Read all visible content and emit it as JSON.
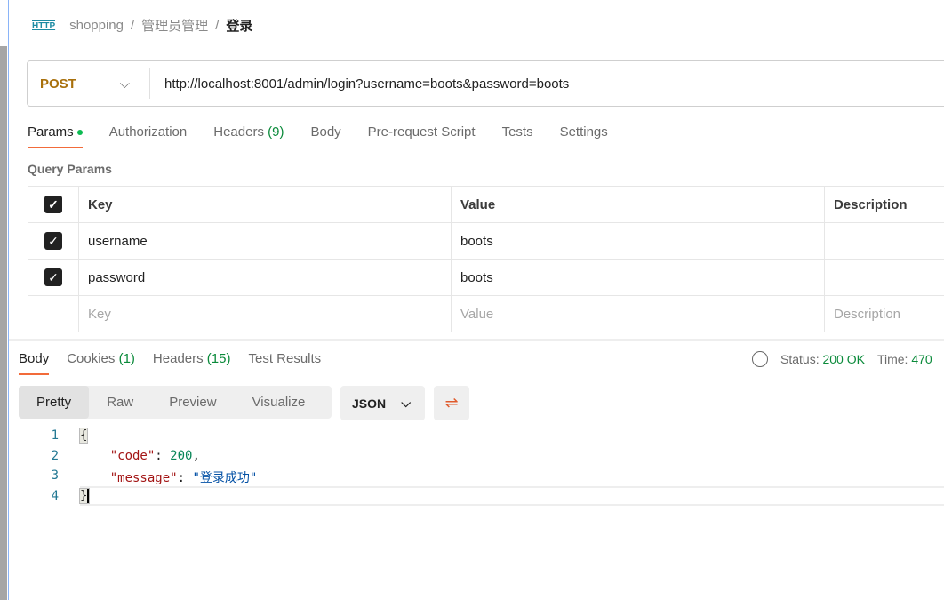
{
  "breadcrumb": {
    "icon": "HTTP",
    "items": [
      "shopping",
      "管理员管理",
      "登录"
    ]
  },
  "request": {
    "method": "POST",
    "url": "http://localhost:8001/admin/login?username=boots&password=boots"
  },
  "request_tabs": [
    {
      "label": "Params"
    },
    {
      "label": "Authorization"
    },
    {
      "label": "Headers",
      "count": "(9)"
    },
    {
      "label": "Body"
    },
    {
      "label": "Pre-request Script"
    },
    {
      "label": "Tests"
    },
    {
      "label": "Settings"
    }
  ],
  "query_params": {
    "title": "Query Params",
    "columns": [
      "Key",
      "Value",
      "Description"
    ],
    "rows": [
      {
        "key": "username",
        "value": "boots",
        "description": ""
      },
      {
        "key": "password",
        "value": "boots",
        "description": ""
      }
    ],
    "placeholder": {
      "key": "Key",
      "value": "Value",
      "description": "Description"
    }
  },
  "response_tabs": [
    {
      "label": "Body"
    },
    {
      "label": "Cookies",
      "count": "(1)"
    },
    {
      "label": "Headers",
      "count": "(15)"
    },
    {
      "label": "Test Results"
    }
  ],
  "status": {
    "label": "Status:",
    "value": "200 OK",
    "time_label": "Time:",
    "time_value": "470"
  },
  "view_modes": [
    "Pretty",
    "Raw",
    "Preview",
    "Visualize"
  ],
  "format": "JSON",
  "body_lines": {
    "l1": "{",
    "code_key": "\"code\"",
    "code_val": "200",
    "msg_key": "\"message\"",
    "msg_val": "\"登录成功\"",
    "l4": "}"
  },
  "line_numbers": [
    "1",
    "2",
    "3",
    "4"
  ]
}
